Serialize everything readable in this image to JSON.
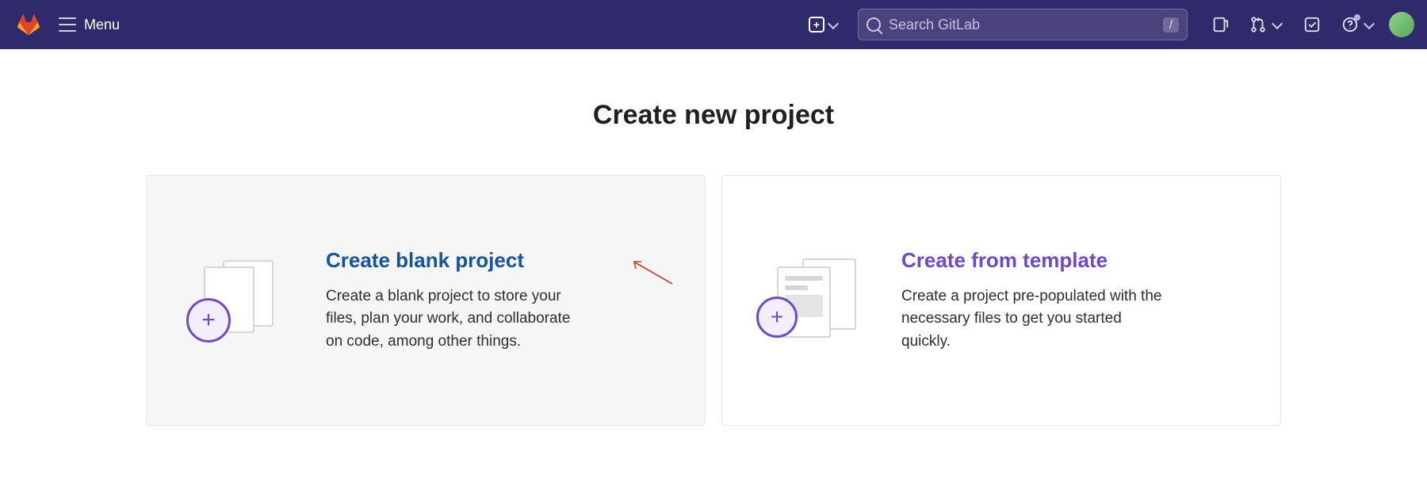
{
  "topbar": {
    "menu_label": "Menu",
    "search_placeholder": "Search GitLab",
    "search_kbd": "/"
  },
  "page": {
    "title": "Create new project"
  },
  "cards": [
    {
      "title": "Create blank project",
      "desc": "Create a blank project to store your files, plan your work, and collaborate on code, among other things."
    },
    {
      "title": "Create from template",
      "desc": "Create a project pre-populated with the necessary files to get you started quickly."
    }
  ]
}
